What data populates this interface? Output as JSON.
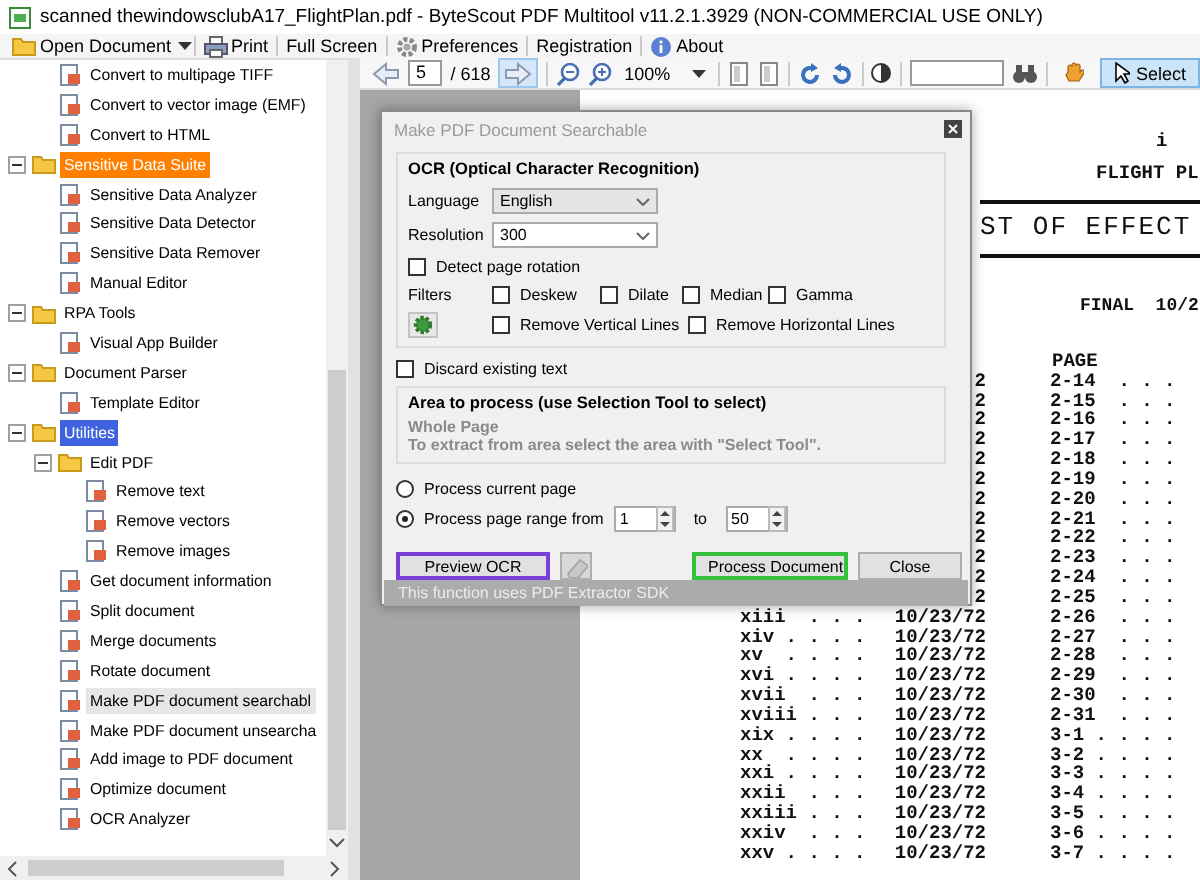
{
  "window": {
    "title": "scanned thewindowsclubA17_FlightPlan.pdf - ByteScout PDF Multitool v11.2.1.3929 (NON-COMMERCIAL USE ONLY)"
  },
  "menu": [
    {
      "label": "Open Document",
      "kind": "open"
    },
    {
      "label": "Print",
      "kind": "print"
    },
    {
      "label": "Full Screen",
      "kind": "text"
    },
    {
      "label": "Preferences",
      "kind": "settings"
    },
    {
      "label": "Registration",
      "kind": "text"
    },
    {
      "label": "About",
      "kind": "about"
    }
  ],
  "tree": [
    {
      "children": [
        {
          "label": "Convert to multipage TIFF",
          "selected": false
        },
        {
          "label": "Convert to vector image (EMF)",
          "selected": false
        },
        {
          "label": "Convert to HTML",
          "selected": false
        }
      ]
    },
    {
      "label": "Sensitive Data Suite",
      "selected": false,
      "color": "#ff8000",
      "expanded": true,
      "children": [
        {
          "label": "Sensitive Data Analyzer",
          "selected": false
        },
        {
          "label": "Sensitive Data Detector",
          "selected": false
        },
        {
          "label": "Sensitive Data Remover",
          "selected": false
        },
        {
          "label": "Manual Editor",
          "selected": false
        }
      ]
    },
    {
      "label": "RPA Tools",
      "selected": false,
      "expanded": true,
      "children": [
        {
          "label": "Visual App Builder",
          "selected": false
        }
      ]
    },
    {
      "label": "Document Parser",
      "selected": false,
      "expanded": true,
      "children": [
        {
          "label": "Template Editor",
          "selected": false
        }
      ]
    },
    {
      "label": "Utilities",
      "selected": false,
      "color": "#3f63e0",
      "expanded": true,
      "children": [
        {
          "label": "Edit PDF",
          "selected": false,
          "expanded": true,
          "children": [
            {
              "label": "Remove text",
              "selected": false
            },
            {
              "label": "Remove vectors",
              "selected": false
            },
            {
              "label": "Remove images",
              "selected": false
            }
          ]
        },
        {
          "label": "Get document information",
          "selected": false
        },
        {
          "label": "Split document",
          "selected": false
        },
        {
          "label": "Merge documents",
          "selected": false
        },
        {
          "label": "Rotate document",
          "selected": false
        },
        {
          "label": "Make PDF document searchabl",
          "selected": true
        },
        {
          "label": "Make PDF document unsearcha",
          "selected": false
        },
        {
          "label": "Add image to PDF document",
          "selected": false
        },
        {
          "label": "Optimize document",
          "selected": false
        },
        {
          "label": "OCR Analyzer",
          "selected": false
        }
      ]
    }
  ],
  "viewer_toolbar": {
    "page": "5",
    "page_total": "/ 618",
    "zoom": "100%",
    "tools": [
      {
        "kind": "hand",
        "selected": false
      },
      {
        "kind": "select",
        "label": "Select",
        "selected": true
      }
    ]
  },
  "dialog": {
    "title": "Make PDF Document Searchable",
    "ocr": {
      "title": "OCR (Optical Character Recognition)",
      "fields": [
        {
          "label": "Language",
          "value": "English",
          "kind": "list"
        },
        {
          "label": "Resolution",
          "value": "300",
          "kind": "combo"
        }
      ],
      "detect_rotation": {
        "label": "Detect page rotation",
        "checked": false
      },
      "filters_label": "Filters",
      "filters": [
        {
          "label": "Deskew",
          "checked": false
        },
        {
          "label": "Dilate",
          "checked": false
        },
        {
          "label": "Median",
          "checked": false
        },
        {
          "label": "Gamma",
          "checked": false
        },
        {
          "label": "Remove Vertical Lines",
          "checked": false
        },
        {
          "label": "Remove Horizontal Lines",
          "checked": false
        }
      ]
    },
    "discard_text": {
      "label": "Discard existing text",
      "checked": false
    },
    "area": {
      "title": "Area to process (use Selection Tool to select)",
      "mode": "Whole Page",
      "hint": "To extract from area select the area with \"Select Tool\"."
    },
    "page_options": [
      {
        "label": "Process current page",
        "selected": false
      },
      {
        "label": "Process page range from",
        "selected": true
      }
    ],
    "range": {
      "from": "1",
      "to_label": "to",
      "to": "50"
    },
    "buttons": [
      {
        "kind": "text",
        "label": "Preview OCR",
        "color": "#7a3fd6"
      },
      {
        "kind": "icon"
      },
      {
        "kind": "text",
        "label": "Process Document",
        "color": "#33c23a"
      },
      {
        "kind": "text",
        "label": "Close"
      }
    ],
    "footer": "This function uses PDF Extractor SDK"
  },
  "document": {
    "page_number": "i",
    "header": "FLIGHT PL",
    "title": "ST OF EFFECT",
    "edition": "FINAL  10/2",
    "column_heading": "PAGE",
    "rows": [
      {
        "date": "2",
        "page": "2-14  . . ."
      },
      {
        "date": "2",
        "page": "2-15  . . ."
      },
      {
        "date": "2",
        "page": "2-16  . . ."
      },
      {
        "date": "2",
        "page": "2-17  . . ."
      },
      {
        "date": "2",
        "page": "2-18  . . ."
      },
      {
        "date": "2",
        "page": "2-19  . . ."
      },
      {
        "date": "2",
        "page": "2-20  . . ."
      },
      {
        "date": "2",
        "page": "2-21  . . ."
      },
      {
        "date": "2",
        "page": "2-22  . . ."
      },
      {
        "date": "2",
        "page": "2-23  . . ."
      },
      {
        "date": "2",
        "page": "2-24  . . ."
      },
      {
        "date": "2",
        "page": "2-25  . . ."
      },
      {
        "roman": "xiii  . . .",
        "date": "10/23/72",
        "page": "2-26  . . ."
      },
      {
        "roman": "xiv . . . .",
        "date": "10/23/72",
        "page": "2-27  . . ."
      },
      {
        "roman": "xv  . . . .",
        "date": "10/23/72",
        "page": "2-28  . . ."
      },
      {
        "roman": "xvi . . . .",
        "date": "10/23/72",
        "page": "2-29  . . ."
      },
      {
        "roman": "xvii  . . .",
        "date": "10/23/72",
        "page": "2-30  . . ."
      },
      {
        "roman": "xviii . . .",
        "date": "10/23/72",
        "page": "2-31  . . ."
      },
      {
        "roman": "xix . . . .",
        "date": "10/23/72",
        "page": "3-1 . . . ."
      },
      {
        "roman": "xx  . . . .",
        "date": "10/23/72",
        "page": "3-2 . . . ."
      },
      {
        "roman": "xxi . . . .",
        "date": "10/23/72",
        "page": "3-3 . . . ."
      },
      {
        "roman": "xxii  . . .",
        "date": "10/23/72",
        "page": "3-4 . . . ."
      },
      {
        "roman": "xxiii . . .",
        "date": "10/23/72",
        "page": "3-5 . . . ."
      },
      {
        "roman": "xxiv  . . .",
        "date": "10/23/72",
        "page": "3-6 . . . ."
      },
      {
        "roman": "xxv . . . .",
        "date": "10/23/72",
        "page": "3-7 . . . ."
      }
    ]
  }
}
